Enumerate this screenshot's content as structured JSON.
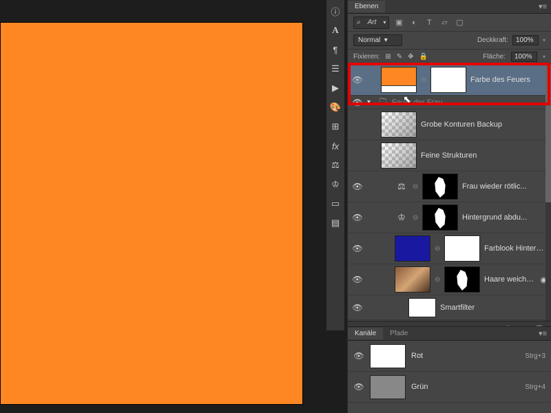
{
  "panel_title": "Ebenen",
  "channels_title": "Kanäle",
  "paths_title": "Pfade",
  "search_mode": "Art",
  "blend_mode": "Normal",
  "opacity_label": "Deckkraft:",
  "opacity_value": "100%",
  "lock_label": "Fixieren:",
  "fill_label": "Fläche:",
  "fill_value": "100%",
  "layers": [
    {
      "name": "Farbe des Feuers"
    },
    {
      "name": "Feuer der Frau"
    },
    {
      "name": "Grobe Konturen Backup"
    },
    {
      "name": "Feine Strukturen"
    },
    {
      "name": "Frau wieder rötlic..."
    },
    {
      "name": "Hintergrund abdu..."
    },
    {
      "name": "Farblook Hintergr..."
    },
    {
      "name": "Haare weichz..."
    },
    {
      "name": "Smartfilter"
    }
  ],
  "channels": [
    {
      "name": "Rot",
      "key": "Strg+3"
    },
    {
      "name": "Grün",
      "key": "Strg+4"
    }
  ]
}
